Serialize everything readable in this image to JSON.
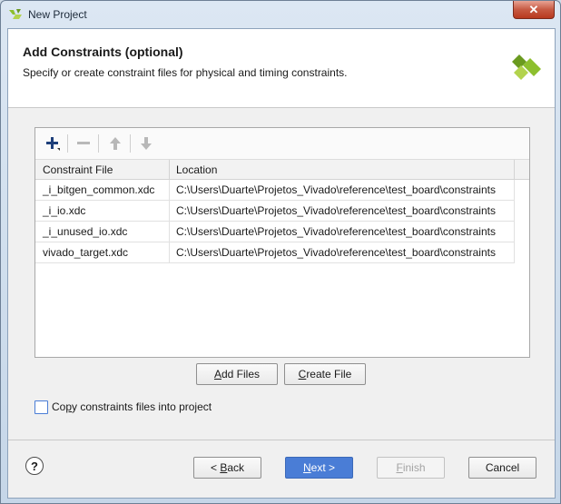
{
  "window": {
    "title": "New Project",
    "close_glyph": "✕"
  },
  "header": {
    "title": "Add Constraints (optional)",
    "subtitle": "Specify or create constraint files for physical and timing constraints."
  },
  "toolbar": {
    "add_icon": "plus-icon",
    "remove_icon": "minus-icon",
    "up_icon": "arrow-up-icon",
    "down_icon": "arrow-down-icon"
  },
  "table": {
    "columns": [
      "Constraint File",
      "Location"
    ],
    "rows": [
      {
        "file": "_i_bitgen_common.xdc",
        "location": "C:\\Users\\Duarte\\Projetos_Vivado\\reference\\test_board\\constraints"
      },
      {
        "file": "_i_io.xdc",
        "location": "C:\\Users\\Duarte\\Projetos_Vivado\\reference\\test_board\\constraints"
      },
      {
        "file": "_i_unused_io.xdc",
        "location": "C:\\Users\\Duarte\\Projetos_Vivado\\reference\\test_board\\constraints"
      },
      {
        "file": "vivado_target.xdc",
        "location": "C:\\Users\\Duarte\\Projetos_Vivado\\reference\\test_board\\constraints"
      }
    ]
  },
  "actions": {
    "add_files_mnemonic": "A",
    "add_files_rest": "dd Files",
    "create_file_mnemonic": "C",
    "create_file_rest": "reate File"
  },
  "options": {
    "copy_label_pre": "Co",
    "copy_label_mnemonic": "p",
    "copy_label_post": "y constraints files into project",
    "copy_checked": false
  },
  "footer": {
    "help": "?",
    "back_pre": "< ",
    "back_mnemonic": "B",
    "back_post": "ack",
    "next_mnemonic": "N",
    "next_post": "ext >",
    "finish_mnemonic": "F",
    "finish_post": "inish",
    "cancel": "Cancel"
  },
  "colors": {
    "accent": "#4a7dd6",
    "logo_green": "#8dbf2e"
  }
}
